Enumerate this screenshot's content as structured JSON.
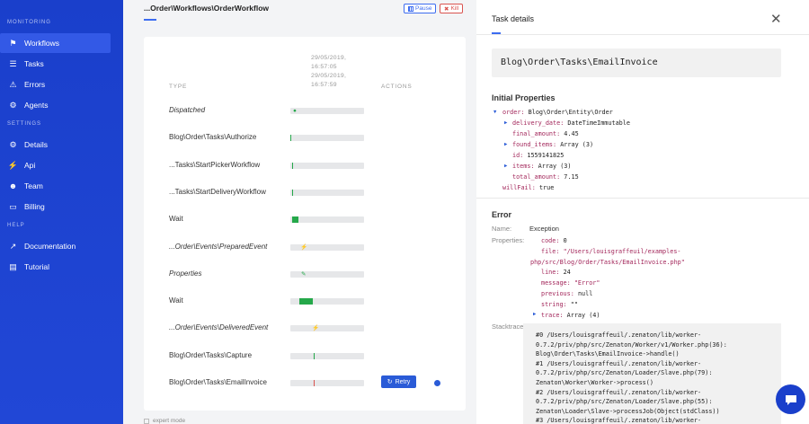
{
  "sidebar": {
    "sections": [
      {
        "heading": "MONITORING",
        "items": [
          {
            "label": "Workflows",
            "icon": "workflows-icon",
            "active": true
          },
          {
            "label": "Tasks",
            "icon": "tasks-icon"
          },
          {
            "label": "Errors",
            "icon": "errors-icon"
          },
          {
            "label": "Agents",
            "icon": "agents-icon"
          }
        ]
      },
      {
        "heading": "SETTINGS",
        "items": [
          {
            "label": "Details",
            "icon": "details-icon"
          },
          {
            "label": "Api",
            "icon": "api-icon"
          },
          {
            "label": "Team",
            "icon": "team-icon"
          },
          {
            "label": "Billing",
            "icon": "billing-icon"
          }
        ]
      },
      {
        "heading": "HELP",
        "items": [
          {
            "label": "Documentation",
            "icon": "documentation-icon"
          },
          {
            "label": "Tutorial",
            "icon": "tutorial-icon"
          }
        ]
      }
    ]
  },
  "main": {
    "title": "...Order\\Workflows\\OrderWorkflow",
    "pause_label": "Pause",
    "kill_label": "Kill",
    "date_start": [
      "29/05/2019,",
      "16:57:05"
    ],
    "date_end": [
      "29/05/2019,",
      "16:57:59"
    ],
    "col_type": "TYPE",
    "col_actions": "ACTIONS",
    "retry_label": "Retry",
    "expert_mode_label": "expert mode",
    "rows": [
      {
        "label": "Dispatched",
        "italic": true,
        "kind": "dot",
        "start": 0.04
      },
      {
        "label": "Blog\\Order\\Tasks\\Authorize",
        "italic": false,
        "kind": "tick",
        "start": 0.0,
        "color": "#25a84a"
      },
      {
        "label": "...Tasks\\StartPickerWorkflow",
        "italic": false,
        "kind": "tick",
        "start": 0.02,
        "color": "#25a84a"
      },
      {
        "label": "...Tasks\\StartDeliveryWorkflow",
        "italic": false,
        "kind": "tick",
        "start": 0.02,
        "color": "#25a84a"
      },
      {
        "label": "Wait",
        "italic": false,
        "kind": "bar",
        "start": 0.03,
        "end": 0.11
      },
      {
        "label": "...Order\\Events\\PreparedEvent",
        "italic": true,
        "kind": "bolt",
        "start": 0.13
      },
      {
        "label": "Properties",
        "italic": true,
        "kind": "pen",
        "start": 0.15
      },
      {
        "label": "Wait",
        "italic": false,
        "kind": "bar",
        "start": 0.12,
        "end": 0.3
      },
      {
        "label": "...Order\\Events\\DeliveredEvent",
        "italic": true,
        "kind": "bolt",
        "start": 0.29
      },
      {
        "label": "Blog\\Order\\Tasks\\Capture",
        "italic": false,
        "kind": "tick",
        "start": 0.32,
        "color": "#25a84a"
      },
      {
        "label": "Blog\\Order\\Tasks\\EmailInvoice",
        "italic": false,
        "kind": "tick",
        "start": 0.32,
        "color": "#d9534f",
        "retry": true
      }
    ]
  },
  "panel": {
    "title": "Task details",
    "task_class": "Blog\\Order\\Tasks\\EmailInvoice",
    "initial_properties_title": "Initial Properties",
    "order_key": "order:",
    "order_class": "Blog\\Order\\Entity\\Order",
    "order_props": [
      {
        "k": "delivery_date:",
        "v": "DateTimeImmutable",
        "expandable": true
      },
      {
        "k": "final_amount:",
        "v": "4.45",
        "expandable": false
      },
      {
        "k": "found_items:",
        "v": "Array (3)",
        "expandable": true
      },
      {
        "k": "id:",
        "v": "1559141825",
        "expandable": false
      },
      {
        "k": "items:",
        "v": "Array (3)",
        "expandable": true
      },
      {
        "k": "total_amount:",
        "v": "7.15",
        "expandable": false
      }
    ],
    "willfail_key": "willFail:",
    "willfail_val": "true",
    "error_title": "Error",
    "name_label": "Name:",
    "name_value": "Exception",
    "properties_label": "Properties:",
    "code_k": "code:",
    "code_v": "0",
    "file_k": "file:",
    "file_v1": "\"/Users/louisgraffeuil/examples-",
    "file_v2": "php/src/Blog/Order/Tasks/EmailInvoice.php\"",
    "line_k": "line:",
    "line_v": "24",
    "message_k": "message:",
    "message_v": "\"Error\"",
    "previous_k": "previous:",
    "previous_v": "null",
    "string_k": "string:",
    "string_v": "\"\"",
    "trace_k": "trace:",
    "trace_v": "Array (4)",
    "stacktrace_label": "Stacktrace:",
    "stacktrace": [
      "#0 /Users/louisgraffeuil/.zenaton/lib/worker-",
      "0.7.2/priv/php/src/Zenaton/Worker/v1/Worker.php(36):",
      "Blog\\Order\\Tasks\\EmailInvoice->handle()",
      "#1 /Users/louisgraffeuil/.zenaton/lib/worker-",
      "0.7.2/priv/php/src/Zenaton/Loader/Slave.php(79):",
      "Zenaton\\Worker\\Worker->process()",
      "#2 /Users/louisgraffeuil/.zenaton/lib/worker-",
      "0.7.2/priv/php/src/Zenaton/Loader/Slave.php(55):",
      "Zenaton\\Loader\\Slave->processJob(Object(stdClass))",
      "#3 /Users/louisgraffeuil/.zenaton/lib/worker-"
    ]
  },
  "colors": {
    "brand": "#1a3fcb",
    "success": "#25a84a",
    "danger": "#d9534f",
    "accent": "#2a5bd7"
  }
}
